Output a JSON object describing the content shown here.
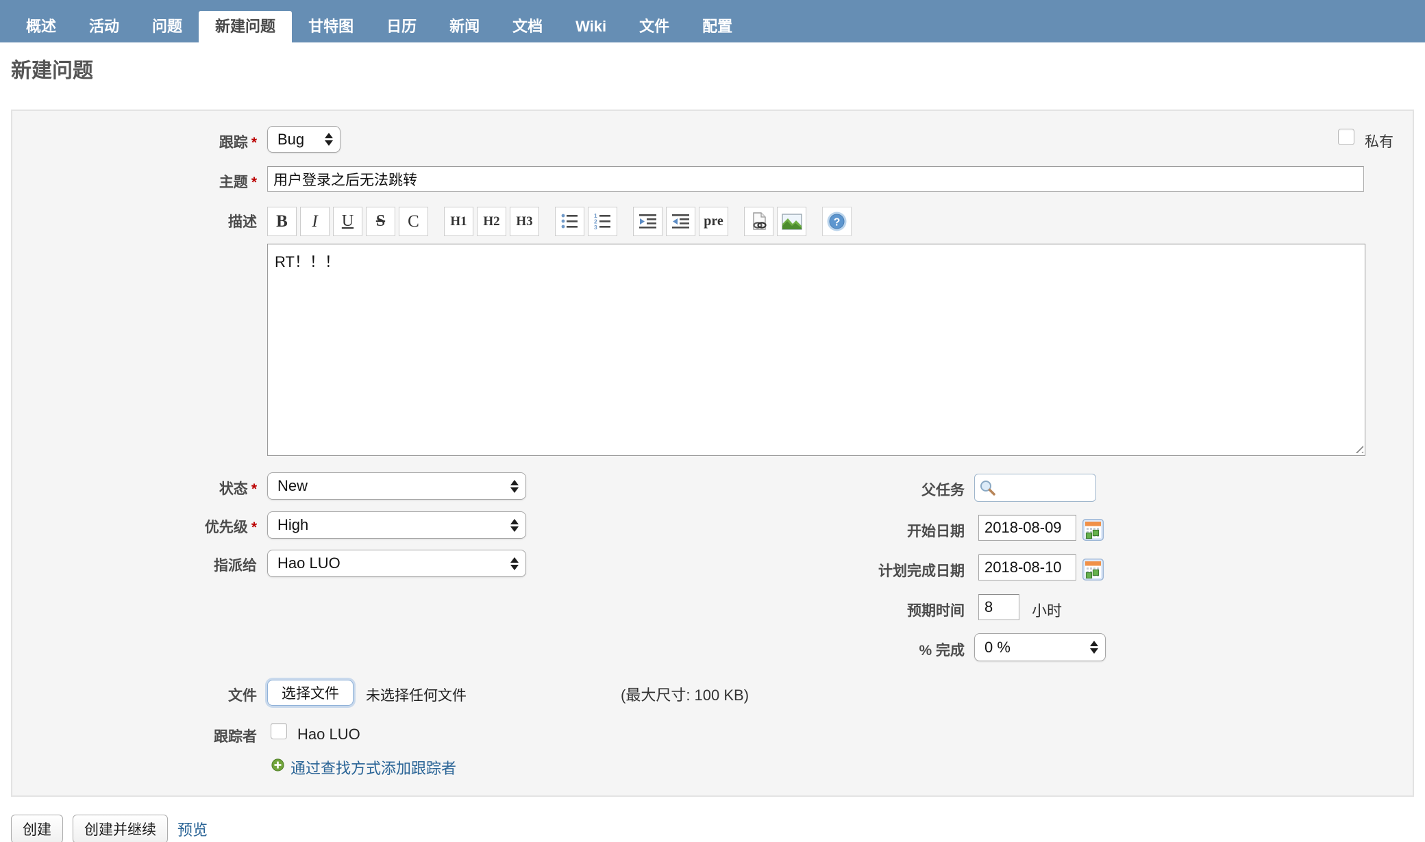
{
  "nav": {
    "tabs": [
      "概述",
      "活动",
      "问题",
      "新建问题",
      "甘特图",
      "日历",
      "新闻",
      "文档",
      "Wiki",
      "文件",
      "配置"
    ],
    "active_tab": "新建问题"
  },
  "page": {
    "title": "新建问题"
  },
  "form": {
    "tracker": {
      "label": "跟踪",
      "required": "*",
      "value": "Bug"
    },
    "private": {
      "label": "私有",
      "checked": false
    },
    "subject": {
      "label": "主题",
      "required": "*",
      "value": "用户登录之后无法跳转"
    },
    "description": {
      "label": "描述",
      "value": "RT！！！"
    },
    "status": {
      "label": "状态",
      "required": "*",
      "value": "New"
    },
    "priority": {
      "label": "优先级",
      "required": "*",
      "value": "High"
    },
    "assignee": {
      "label": "指派给",
      "value": "Hao LUO"
    },
    "parent_task": {
      "label": "父任务",
      "value": ""
    },
    "start_date": {
      "label": "开始日期",
      "value": "2018-08-09"
    },
    "due_date": {
      "label": "计划完成日期",
      "value": "2018-08-10"
    },
    "estimated_time": {
      "label": "预期时间",
      "value": "8",
      "unit": "小时"
    },
    "done_ratio": {
      "label": "% 完成",
      "value": "0 %"
    },
    "files": {
      "label": "文件",
      "button": "选择文件",
      "no_file": "未选择任何文件",
      "max_size": "(最大尺寸: 100 KB)"
    },
    "watchers": {
      "label": "跟踪者",
      "options": [
        {
          "name": "Hao LUO",
          "checked": false
        }
      ],
      "add_link": "通过查找方式添加跟踪者"
    }
  },
  "toolbar": {
    "bold": "B",
    "italic": "I",
    "underline": "U",
    "strikethrough": "S",
    "code": "C",
    "h1": "H1",
    "h2": "H2",
    "h3": "H3",
    "pre": "pre",
    "icon_buttons": [
      "unordered-list",
      "ordered-list",
      "indent",
      "outdent",
      "link",
      "image",
      "help"
    ]
  },
  "actions": {
    "create": "创建",
    "create_and_continue": "创建并继续",
    "preview": "预览"
  },
  "colors": {
    "nav_background": "#668eb4",
    "active_tab_background": "#ffffff",
    "link": "#2a6496",
    "required_asterisk": "#bb0000",
    "form_box_background": "#f5f5f5",
    "watcher_add_icon_green": "#72a43c",
    "calendar_icon_orange": "#f09048"
  }
}
